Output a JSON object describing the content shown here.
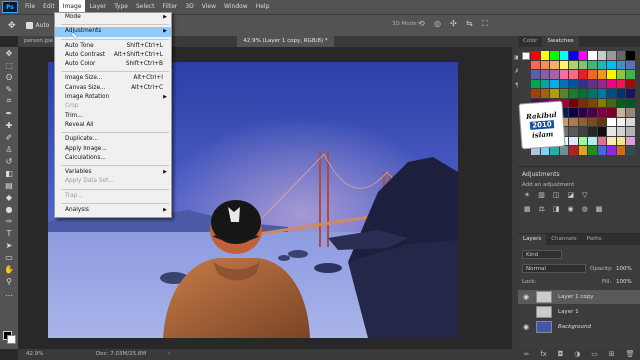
{
  "menubar": {
    "logo": "Ps",
    "items": [
      "File",
      "Edit",
      "Image",
      "Layer",
      "Type",
      "Select",
      "Filter",
      "3D",
      "View",
      "Window",
      "Help"
    ],
    "active_index": 2
  },
  "options": {
    "checkbox_label": "Auto",
    "mode_3d": "3D Mode:"
  },
  "tabs": [
    {
      "label": "person.jpe"
    },
    {
      "label": "42.9% (Layer 1 copy, RGB/8) *"
    }
  ],
  "status": {
    "zoom": "42.9%",
    "doc": "Doc: 7.03M/25.8M",
    "arrow": "›"
  },
  "menu": {
    "groups": [
      [
        {
          "label": "Mode",
          "submenu": true
        }
      ],
      [
        {
          "label": "Adjustments",
          "submenu": true,
          "highlight": true
        }
      ],
      [
        {
          "label": "Auto Tone",
          "shortcut": "Shift+Ctrl+L"
        },
        {
          "label": "Auto Contrast",
          "shortcut": "Alt+Shift+Ctrl+L"
        },
        {
          "label": "Auto Color",
          "shortcut": "Shift+Ctrl+B"
        }
      ],
      [
        {
          "label": "Image Size...",
          "shortcut": "Alt+Ctrl+I"
        },
        {
          "label": "Canvas Size...",
          "shortcut": "Alt+Ctrl+C"
        },
        {
          "label": "Image Rotation",
          "submenu": true
        },
        {
          "label": "Crop",
          "disabled": true
        },
        {
          "label": "Trim..."
        },
        {
          "label": "Reveal All"
        }
      ],
      [
        {
          "label": "Duplicate..."
        },
        {
          "label": "Apply Image..."
        },
        {
          "label": "Calculations..."
        }
      ],
      [
        {
          "label": "Variables",
          "submenu": true
        },
        {
          "label": "Apply Data Set...",
          "disabled": true
        }
      ],
      [
        {
          "label": "Trap...",
          "disabled": true
        }
      ],
      [
        {
          "label": "Analysis",
          "submenu": true
        }
      ]
    ]
  },
  "panels": {
    "color_tabs": [
      "Color",
      "Swatches"
    ],
    "watermark": {
      "line1": "Rakibul",
      "line2": "2010",
      "line3": "islam"
    },
    "adjustments": {
      "title": "Adjustments",
      "subtitle": "Add an adjustment"
    },
    "layer_tabs": [
      "Layers",
      "Channels",
      "Paths"
    ],
    "kind_filter": "Kind",
    "blend_mode": "Normal",
    "opacity_label": "Opacity:",
    "opacity_value": "100%",
    "lock_label": "Lock:",
    "fill_label": "Fill:",
    "fill_value": "100%",
    "layers": [
      {
        "name": "Layer 1 copy",
        "selected": true
      },
      {
        "name": "Layer 1"
      },
      {
        "name": "Background"
      }
    ]
  },
  "colors": {
    "accent": "#31a8ff",
    "menu_highlight": "#91c9f7",
    "panel": "#3c3c3c",
    "chrome": "#535353"
  }
}
